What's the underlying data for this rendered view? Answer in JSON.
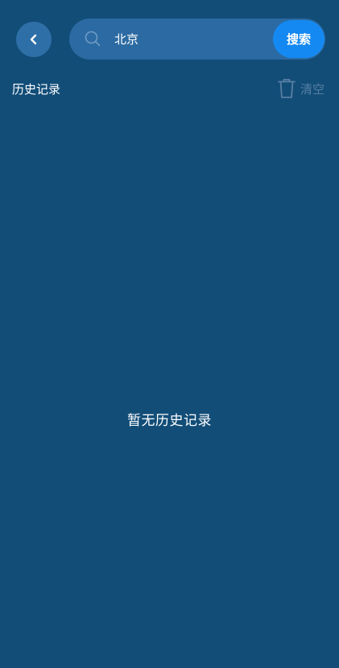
{
  "header": {
    "back_icon": "chevron-left-icon",
    "search": {
      "icon": "search-icon",
      "value": "北京",
      "placeholder": "",
      "button_label": "搜索"
    }
  },
  "history": {
    "title": "历史记录",
    "clear_label": "清空",
    "clear_icon": "trash-icon",
    "empty_text": "暂无历史记录"
  },
  "colors": {
    "background": "#124d78",
    "search_field": "#2b6aa2",
    "back_button": "#2e6fa8",
    "search_button": "#1589f2",
    "muted": "#587fa3"
  }
}
